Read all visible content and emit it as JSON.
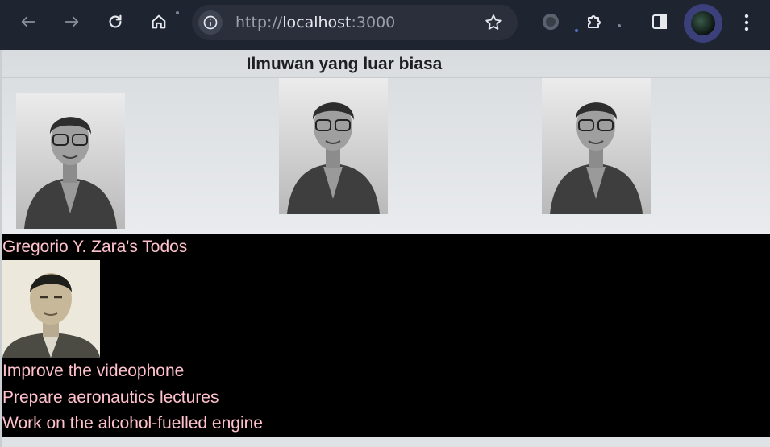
{
  "browser": {
    "url_scheme": "http://",
    "url_host": "localhost",
    "url_port": ":3000"
  },
  "gallery": {
    "title": "Ilmuwan yang luar biasa"
  },
  "todos": {
    "heading": "Gregorio Y. Zara's Todos",
    "items": [
      "Improve the videophone",
      "Prepare aeronautics lectures",
      "Work on the alcohol-fuelled engine"
    ]
  },
  "colors": {
    "browser_bg": "#1f2431",
    "page_bg": "#dfe3e6",
    "todos_bg": "#000000",
    "todos_text": "#ffc1cc"
  }
}
